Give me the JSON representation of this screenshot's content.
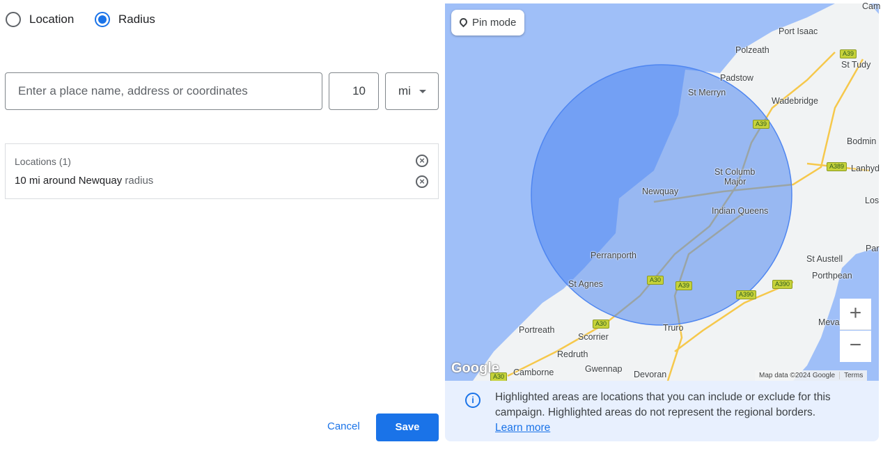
{
  "mode": {
    "options": [
      {
        "label": "Location",
        "selected": false
      },
      {
        "label": "Radius",
        "selected": true
      }
    ]
  },
  "search": {
    "placeholder": "Enter a place name, address or coordinates",
    "value": ""
  },
  "radius": {
    "value": "10",
    "unit": "mi"
  },
  "locations": {
    "header": "Locations (1)",
    "items": [
      {
        "main": "10 mi around Newquay",
        "suffix": " radius"
      }
    ]
  },
  "map": {
    "pin_mode": "Pin mode",
    "attribution": "Map data ©2024 Google",
    "terms": "Terms",
    "logo": "Google",
    "zoom_in": "+",
    "zoom_out": "−",
    "places": [
      "Cam",
      "Port Isaac",
      "Polzeath",
      "St Tudy",
      "Padstow",
      "St Merryn",
      "Wadebridge",
      "Bodmin",
      "Lanhyd",
      "St Columb",
      "Major",
      "Newquay",
      "Los",
      "Indian Queens",
      "Par",
      "Perranporth",
      "St Austell",
      "Porthpean",
      "St Agnes",
      "Mevagiss",
      "Portreath",
      "Truro",
      "Scorrier",
      "Redruth",
      "Gwennap",
      "Devoran",
      "Camborne"
    ],
    "roads": [
      "A39",
      "A39",
      "A389",
      "A30",
      "A39",
      "A390",
      "A390",
      "A30",
      "A30"
    ],
    "colors": {
      "sea": "#9fbff8",
      "land": "#f1f3f4",
      "radius_fill": "#4f86f0",
      "road": "#f6c84b"
    }
  },
  "info": {
    "text": "Highlighted areas are locations that you can include or exclude for this campaign. Highlighted areas do not represent the regional borders.",
    "link": "Learn more"
  },
  "actions": {
    "cancel": "Cancel",
    "save": "Save"
  },
  "colors": {
    "accent": "#1a73e8"
  }
}
